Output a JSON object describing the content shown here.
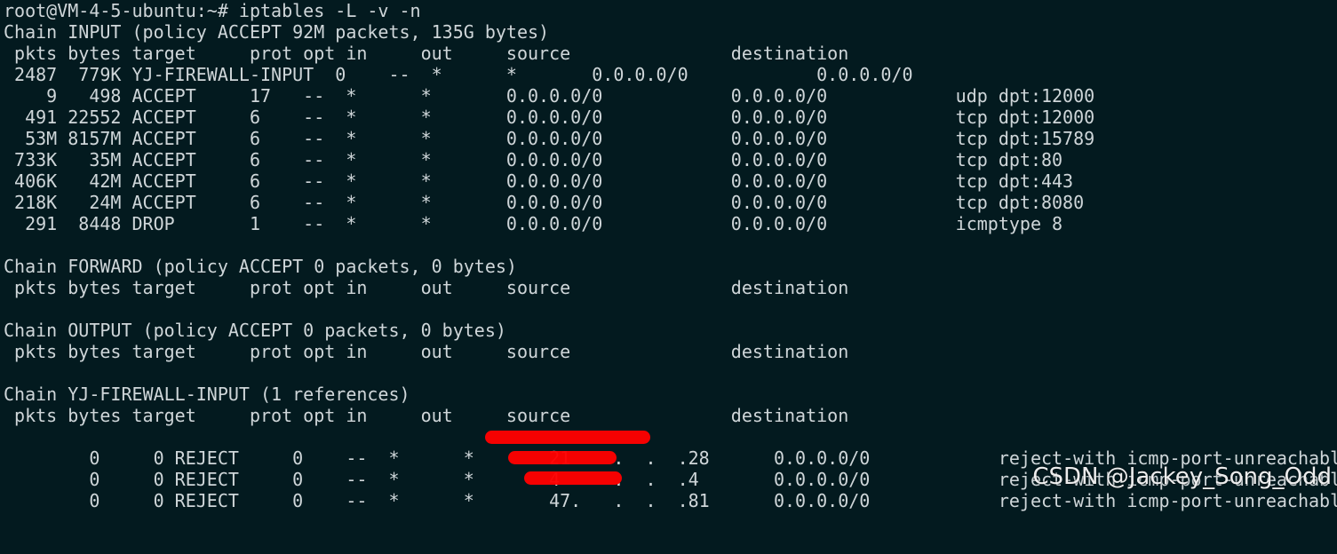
{
  "colors": {
    "background": "#031a1f",
    "text": "#cfd6d9",
    "redaction": "#ff0000"
  },
  "terminal": {
    "lines": [
      "root@VM-4-5-ubuntu:~# iptables -L -v -n",
      "Chain INPUT (policy ACCEPT 92M packets, 135G bytes)",
      " pkts bytes target     prot opt in     out     source               destination",
      " 2487  779K YJ-FIREWALL-INPUT  0    --  *      *       0.0.0.0/0            0.0.0.0/0",
      "    9   498 ACCEPT     17   --  *      *       0.0.0.0/0            0.0.0.0/0            udp dpt:12000",
      "  491 22552 ACCEPT     6    --  *      *       0.0.0.0/0            0.0.0.0/0            tcp dpt:12000",
      "  53M 8157M ACCEPT     6    --  *      *       0.0.0.0/0            0.0.0.0/0            tcp dpt:15789",
      " 733K   35M ACCEPT     6    --  *      *       0.0.0.0/0            0.0.0.0/0            tcp dpt:80",
      " 406K   42M ACCEPT     6    --  *      *       0.0.0.0/0            0.0.0.0/0            tcp dpt:443",
      " 218K   24M ACCEPT     6    --  *      *       0.0.0.0/0            0.0.0.0/0            tcp dpt:8080",
      "  291  8448 DROP       1    --  *      *       0.0.0.0/0            0.0.0.0/0            icmptype 8",
      "",
      "Chain FORWARD (policy ACCEPT 0 packets, 0 bytes)",
      " pkts bytes target     prot opt in     out     source               destination",
      "",
      "Chain OUTPUT (policy ACCEPT 0 packets, 0 bytes)",
      " pkts bytes target     prot opt in     out     source               destination",
      "",
      "Chain YJ-FIREWALL-INPUT (1 references)",
      " pkts bytes target     prot opt in     out     source               destination",
      "    0     0 REJECT     0    --  *      *       21    .  .  .28      0.0.0.0/0            reject-with icmp-port-unreachable",
      "    0     0 REJECT     0    --  *      *       4     .  .  .4       0.0.0.0/0            reject-with icmp-port-unreachable",
      "    0     0 REJECT     0    --  *      *       47.   .  .  .81      0.0.0.0/0            reject-with icmp-port-unreachable"
    ]
  },
  "watermark": "CSDN @Jackey_Song_Odd"
}
